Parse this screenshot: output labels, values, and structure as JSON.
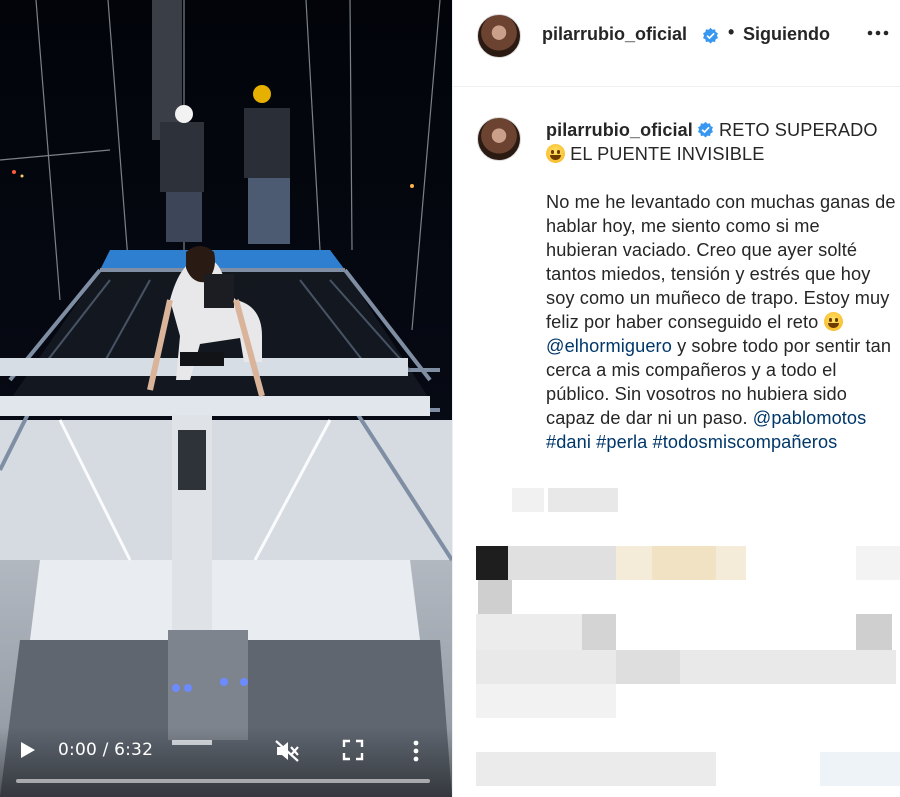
{
  "video": {
    "time_display": "0:00 / 6:32",
    "progress": 0.0
  },
  "header": {
    "username": "pilarrubio_oficial",
    "separator": "•",
    "follow_label": "Siguiendo"
  },
  "caption": {
    "username": "pilarrubio_oficial",
    "title_line1": "RETO SUPERADO",
    "title_line2": "EL PUENTE INVISIBLE",
    "body_part1": "No me he levantado con muchas ganas de hablar hoy, me siento como si me hubieran vaciado. Creo que ayer solté tantos miedos, tensión y estrés que hoy soy como un muñeco de trapo. Estoy muy feliz por haber conseguido el reto",
    "mention1": "@elhormiguero",
    "body_part2": "y sobre todo por sentir tan cerca a mis compañeros y a todo el público. Sin vosotros no hubiera sido capaz de dar ni un paso.",
    "mention2": "@pablomotos",
    "hashtag1": "#dani",
    "hashtag2": "#perla",
    "hashtag3": "#todosmiscompañeros"
  },
  "icons": {
    "play": "play-icon",
    "mute": "muted-speaker-icon",
    "fullscreen": "fullscreen-icon",
    "more": "vertical-dots-icon",
    "verified": "verified-badge-icon",
    "options": "horizontal-dots-icon"
  },
  "colors": {
    "link": "#00376b",
    "verified": "#3897f0",
    "text": "#262626"
  }
}
